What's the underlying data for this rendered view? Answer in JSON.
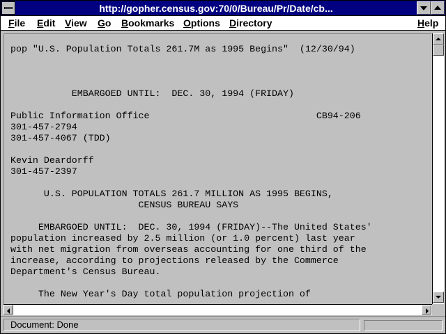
{
  "window": {
    "title": "http://gopher.census.gov:70/0/Bureau/Pr/Date/cb...",
    "title_bar_color": "#000080"
  },
  "menu": {
    "items": [
      "File",
      "Edit",
      "View",
      "Go",
      "Bookmarks",
      "Options",
      "Directory"
    ],
    "help": "Help"
  },
  "document": {
    "lines": [
      "pop \"U.S. Population Totals 261.7M as 1995 Begins\"  (12/30/94)",
      "",
      "",
      "",
      "           EMBARGOED UNTIL:  DEC. 30, 1994 (FRIDAY)",
      "",
      "Public Information Office                              CB94-206",
      "301-457-2794",
      "301-457-4067 (TDD)",
      "",
      "Kevin Deardorff",
      "301-457-2397",
      "",
      "      U.S. POPULATION TOTALS 261.7 MILLION AS 1995 BEGINS,",
      "                       CENSUS BUREAU SAYS",
      "",
      "     EMBARGOED UNTIL:  DEC. 30, 1994 (FRIDAY)--The United States'",
      "population increased by 2.5 million (or 1.0 percent) last year",
      "with net migration from overseas accounting for one third of the",
      "increase, according to projections released by the Commerce",
      "Department's Census Bureau.",
      "",
      "     The New Year's Day total population projection of"
    ]
  },
  "status": {
    "text": "Document: Done"
  }
}
